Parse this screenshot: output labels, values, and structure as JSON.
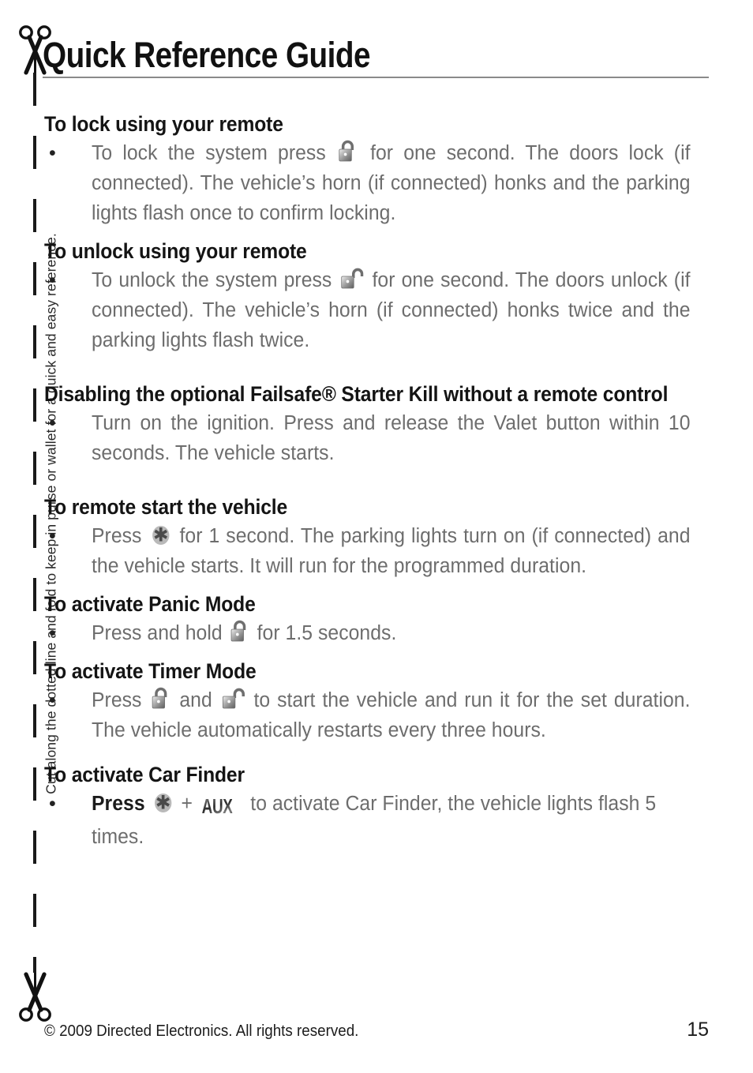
{
  "title": "Quick Reference Guide",
  "side_note": "Cut along the dotted line and fold to keep in purse or wallet for a quick and easy reference.",
  "icons": {
    "lock": "lock-closed-icon",
    "unlock": "lock-open-icon",
    "star": "asterisk-button-icon",
    "aux": "AUX",
    "scissors": "scissors-icon"
  },
  "bullet_char": "•",
  "sections": [
    {
      "heading": "To lock using your remote",
      "bullets": [
        {
          "parts": [
            {
              "type": "text",
              "value": "To lock the system press "
            },
            {
              "type": "icon",
              "value": "lock"
            },
            {
              "type": "text",
              "value": " for one second. The doors lock (if connected). The vehicle’s horn (if connected) honks and the parking lights flash once to confirm locking."
            }
          ]
        }
      ]
    },
    {
      "heading": "To unlock using your remote",
      "bullets": [
        {
          "parts": [
            {
              "type": "text",
              "value": "To unlock the system press "
            },
            {
              "type": "icon",
              "value": "unlock"
            },
            {
              "type": "text",
              "value": " for one second. The doors unlock (if connected). The vehicle’s horn (if connected) honks twice and the parking lights flash twice."
            }
          ]
        }
      ]
    },
    {
      "heading": "Disabling the optional Failsafe® Starter Kill without a remote control",
      "bullets": [
        {
          "parts": [
            {
              "type": "text",
              "value": "Turn on the ignition. Press and release the Valet button within 10 seconds. The vehicle starts."
            }
          ]
        }
      ]
    },
    {
      "heading": "To remote start the vehicle",
      "bullets": [
        {
          "parts": [
            {
              "type": "text",
              "value": "Press "
            },
            {
              "type": "icon",
              "value": "star"
            },
            {
              "type": "text",
              "value": " for 1 second. The parking lights turn on (if connected) and the vehicle starts. It will run for the programmed duration."
            }
          ]
        }
      ]
    },
    {
      "heading": "To activate Panic Mode",
      "bullets": [
        {
          "parts": [
            {
              "type": "text",
              "value": "Press and hold "
            },
            {
              "type": "icon",
              "value": "lock"
            },
            {
              "type": "text",
              "value": " for 1.5 seconds."
            }
          ]
        }
      ]
    },
    {
      "heading": "To activate Timer Mode",
      "bullets": [
        {
          "parts": [
            {
              "type": "text",
              "value": "Press "
            },
            {
              "type": "icon",
              "value": "lock"
            },
            {
              "type": "text",
              "value": " and "
            },
            {
              "type": "icon",
              "value": "unlock"
            },
            {
              "type": "text",
              "value": " to start the vehicle and run it for the set duration. The vehicle automatically  restarts every three hours."
            }
          ]
        }
      ]
    },
    {
      "heading": "To activate Car Finder",
      "bullets": [
        {
          "parts": [
            {
              "type": "bold",
              "value": "Press "
            },
            {
              "type": "icon",
              "value": "star"
            },
            {
              "type": "text",
              "value": "  +  "
            },
            {
              "type": "icon",
              "value": "aux"
            },
            {
              "type": "text",
              "value": " to activate Car Finder, the vehicle lights flash 5 times."
            }
          ]
        }
      ]
    }
  ],
  "footer": {
    "copyright": "© 2009 Directed Electronics. All rights reserved.",
    "page_number": "15"
  }
}
